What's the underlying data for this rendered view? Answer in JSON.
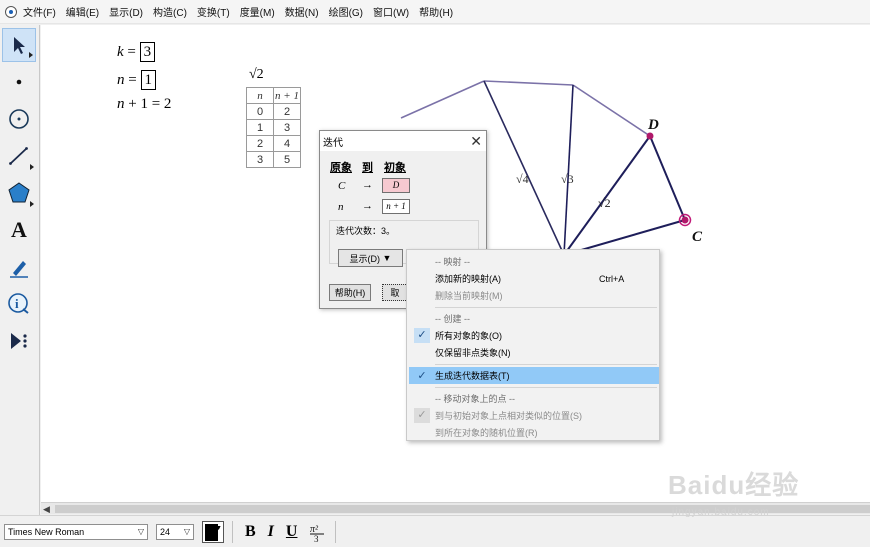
{
  "menu": [
    "文件(F)",
    "编辑(E)",
    "显示(D)",
    "构造(C)",
    "变换(T)",
    "度量(M)",
    "数据(N)",
    "绘图(G)",
    "窗口(W)",
    "帮助(H)"
  ],
  "params": {
    "k": {
      "name": "k",
      "value": "3"
    },
    "n": {
      "name": "n",
      "value": "1"
    },
    "expr": {
      "name": "n",
      "rest": "+ 1 = 2"
    }
  },
  "table": {
    "caption": "√2",
    "headers": [
      "n",
      "n + 1"
    ],
    "rows": [
      [
        "0",
        "2"
      ],
      [
        "1",
        "3"
      ],
      [
        "2",
        "4"
      ],
      [
        "3",
        "5"
      ]
    ]
  },
  "figure": {
    "point_labels": [
      "D",
      "C"
    ],
    "segment_labels": [
      "√4",
      "√3",
      "√2"
    ],
    "line_color": "#1e1e5a",
    "faded_line_color": "#7b72a8",
    "point_color": "#b0186a"
  },
  "dialog": {
    "title": "迭代",
    "col_pre": "原象",
    "col_to": "到",
    "col_init": "初象",
    "rows": [
      {
        "var": "C",
        "arrow": "→",
        "value": "D"
      },
      {
        "var": "n",
        "arrow": "→",
        "value": "n + 1"
      }
    ],
    "count": "迭代次数：3。",
    "show_button": "显示(D)",
    "help_button": "帮助(H)",
    "cancel_button": "取"
  },
  "context_menu": {
    "mapping_header": "-- 映射 --",
    "add_mapping": "添加新的映射(A)",
    "add_mapping_shortcut": "Ctrl+A",
    "delete_mapping": "删除当前映射(M)",
    "create_header": "-- 创建 --",
    "all_images": "所有对象的象(O)",
    "non_point_images": "仅保留非点类象(N)",
    "gen_table": "生成迭代数据表(T)",
    "move_header": "-- 移动对象上的点 --",
    "move_relative": "到与初始对象上点相对类似的位置(S)",
    "move_random": "到所在对象的随机位置(R)"
  },
  "format_bar": {
    "font": "Times New Roman",
    "size": "24",
    "bold": "B",
    "italic": "I",
    "underline": "U"
  },
  "watermark": {
    "main": "Baidu经验",
    "sub": "jingyan.baidu.com"
  }
}
